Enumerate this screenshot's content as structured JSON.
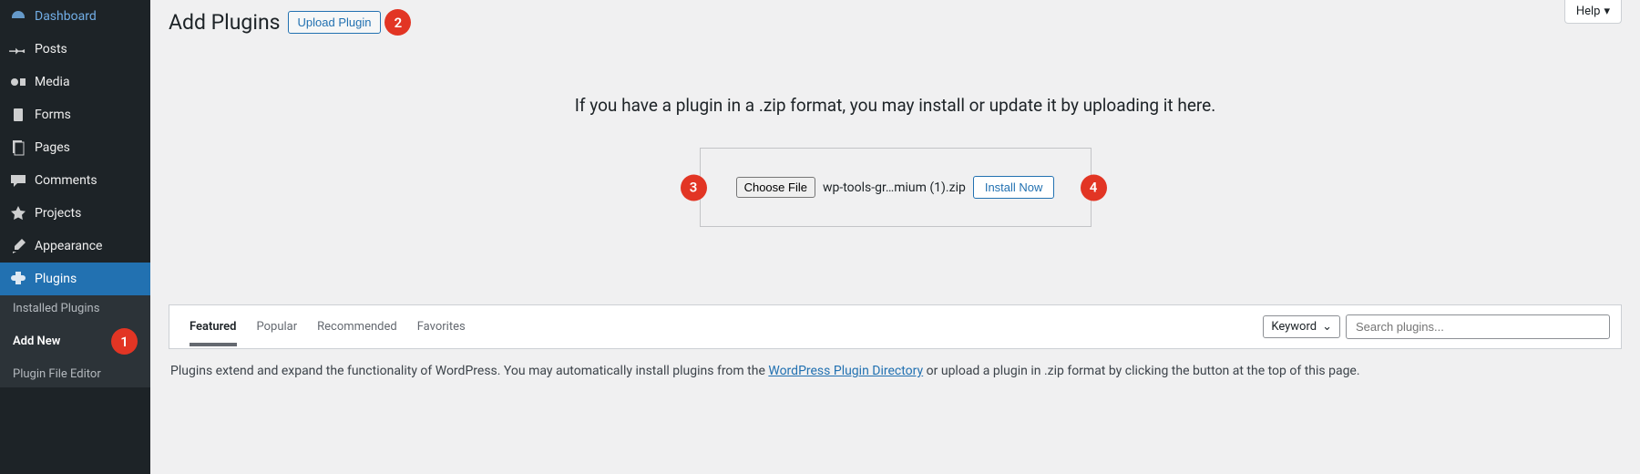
{
  "sidebar": {
    "items": [
      {
        "label": "Dashboard"
      },
      {
        "label": "Posts"
      },
      {
        "label": "Media"
      },
      {
        "label": "Forms"
      },
      {
        "label": "Pages"
      },
      {
        "label": "Comments"
      },
      {
        "label": "Projects"
      },
      {
        "label": "Appearance"
      },
      {
        "label": "Plugins"
      }
    ],
    "submenu": [
      {
        "label": "Installed Plugins"
      },
      {
        "label": "Add New"
      },
      {
        "label": "Plugin File Editor"
      }
    ]
  },
  "help": {
    "label": "Help"
  },
  "header": {
    "title": "Add Plugins",
    "upload_btn": "Upload Plugin"
  },
  "upload": {
    "note": "If you have a plugin in a .zip format, you may install or update it by uploading it here.",
    "choose_file": "Choose File",
    "filename": "wp-tools-gr…mium (1).zip",
    "install_btn": "Install Now"
  },
  "tabs": [
    {
      "label": "Featured",
      "active": true
    },
    {
      "label": "Popular"
    },
    {
      "label": "Recommended"
    },
    {
      "label": "Favorites"
    }
  ],
  "search": {
    "dropdown_label": "Keyword",
    "placeholder": "Search plugins..."
  },
  "description": {
    "pre": "Plugins extend and expand the functionality of WordPress. You may automatically install plugins from the ",
    "link": "WordPress Plugin Directory",
    "post": " or upload a plugin in .zip format by clicking the button at the top of this page."
  },
  "annotations": {
    "b1": "1",
    "b2": "2",
    "b3": "3",
    "b4": "4"
  }
}
